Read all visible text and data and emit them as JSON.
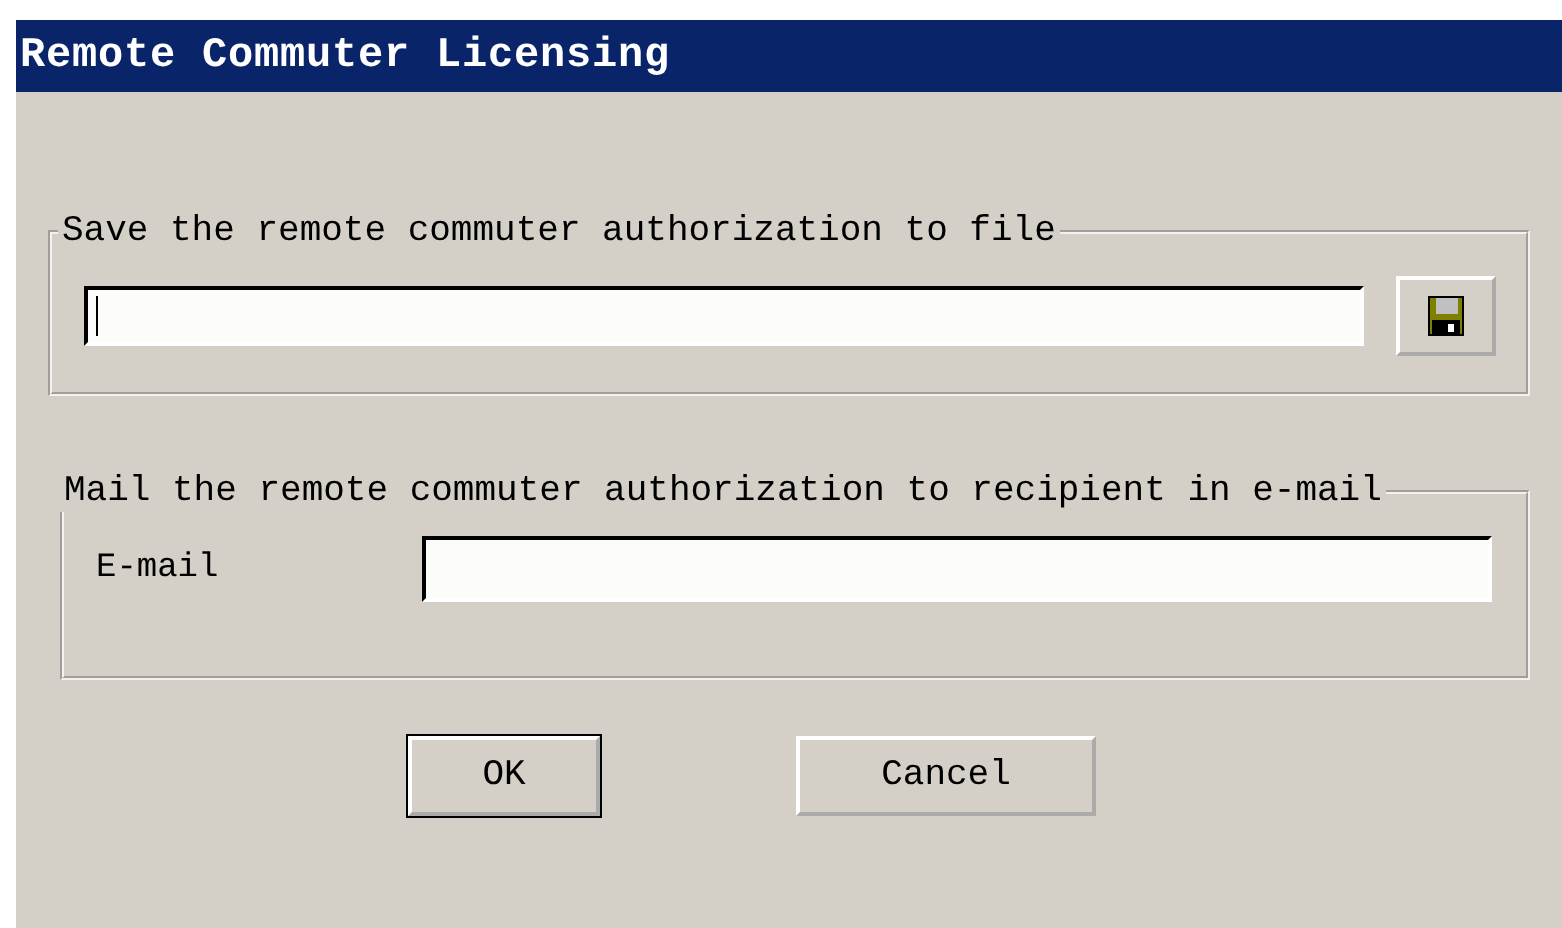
{
  "window": {
    "title": "Remote Commuter Licensing"
  },
  "save_group": {
    "label": "Save the remote commuter authorization to file",
    "file_field": {
      "focused": true
    }
  },
  "mail_group": {
    "label": "Mail the remote commuter authorization to recipient in e-mail",
    "email_label": "E-mail",
    "email_field": {
      "focused": false
    }
  },
  "buttons": [
    {
      "label": "OK",
      "default": true
    },
    {
      "label": "Cancel",
      "default": false
    }
  ]
}
